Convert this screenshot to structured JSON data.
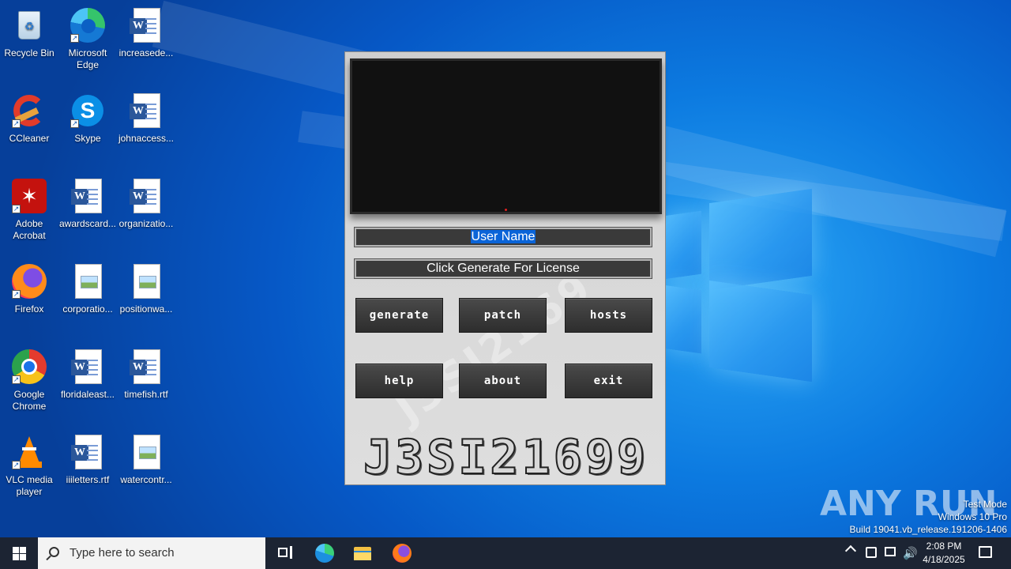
{
  "desktop": {
    "icons": [
      {
        "label": "Recycle Bin",
        "icon": "recycle-bin-icon"
      },
      {
        "label": "Microsoft Edge",
        "icon": "edge-icon"
      },
      {
        "label": "increasede...",
        "icon": "word-doc-icon"
      },
      {
        "label": "CCleaner",
        "icon": "ccleaner-icon"
      },
      {
        "label": "Skype",
        "icon": "skype-icon"
      },
      {
        "label": "johnaccess...",
        "icon": "word-doc-icon"
      },
      {
        "label": "Adobe Acrobat",
        "icon": "acrobat-icon"
      },
      {
        "label": "awardscard...",
        "icon": "word-doc-icon"
      },
      {
        "label": "organizatio...",
        "icon": "word-doc-icon"
      },
      {
        "label": "Firefox",
        "icon": "firefox-icon"
      },
      {
        "label": "corporatio...",
        "icon": "image-file-icon"
      },
      {
        "label": "positionwa...",
        "icon": "image-file-icon"
      },
      {
        "label": "Google Chrome",
        "icon": "chrome-icon"
      },
      {
        "label": "floridaleast...",
        "icon": "word-doc-icon"
      },
      {
        "label": "timefish.rtf",
        "icon": "word-doc-icon"
      },
      {
        "label": "VLC media player",
        "icon": "vlc-icon"
      },
      {
        "label": "iiiletters.rtf",
        "icon": "word-doc-icon"
      },
      {
        "label": "watercontr...",
        "icon": "image-file-icon"
      }
    ]
  },
  "app": {
    "username_field": {
      "value": "User Name"
    },
    "license_field": {
      "value": "Click Generate For License"
    },
    "buttons": {
      "generate": "Generate",
      "patch": "Patch",
      "hosts": "Hosts",
      "help": "Help",
      "about": "About",
      "exit": "Exit"
    },
    "logo_text": "J3SI21699",
    "watermark_text": "J3SI2169"
  },
  "watermark": {
    "anyrun": "ANY RUN",
    "test_mode": "Test Mode",
    "edition": "Windows 10 Pro",
    "build": "Build 19041.vb_release.191206-1406"
  },
  "taskbar": {
    "search_placeholder": "Type here to search",
    "time": "2:08 PM",
    "date": "4/18/2025"
  },
  "colors": {
    "taskbar_bg": "#1c2433",
    "selection_blue": "#0a64d8",
    "desktop_blue": "#0c7ae0"
  }
}
